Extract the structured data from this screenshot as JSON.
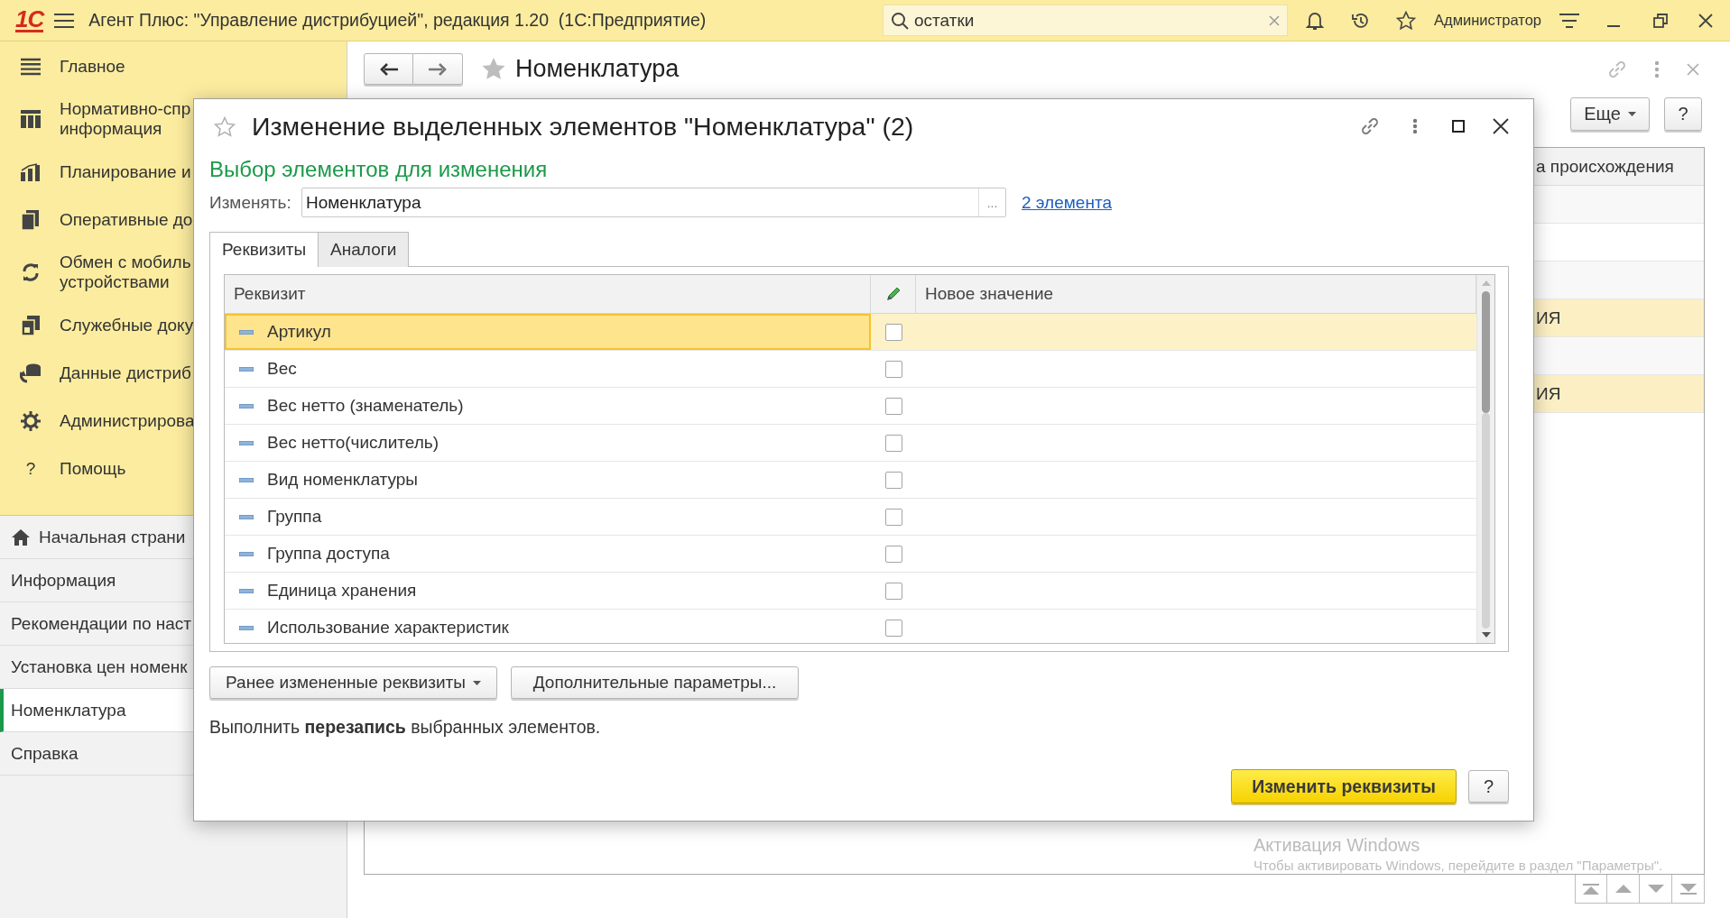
{
  "app": {
    "logo": "1С",
    "title": "Агент Плюс: \"Управление дистрибуцией\", редакция 1.20  (1С:Предприятие)",
    "search": {
      "value": "остатки"
    },
    "user": "Администратор"
  },
  "sidebar": {
    "sections": [
      {
        "label": "Главное"
      },
      {
        "label": "Нормативно-спр\nинформация"
      },
      {
        "label": "Планирование и"
      },
      {
        "label": "Оперативные до"
      },
      {
        "label": "Обмен с мобиль\nустройствами"
      },
      {
        "label": "Служебные доку"
      },
      {
        "label": "Данные дистриб"
      },
      {
        "label": "Администрирова"
      },
      {
        "label": "Помощь",
        "glyph": "?"
      }
    ],
    "open_windows": [
      {
        "label": "Начальная страни",
        "selected": false
      },
      {
        "label": "Информация",
        "selected": false
      },
      {
        "label": "Рекомендации по наст",
        "selected": false
      },
      {
        "label": "Установка цен номенк",
        "selected": false
      },
      {
        "label": "Номенклатура",
        "selected": true
      },
      {
        "label": "Справка",
        "selected": false
      }
    ]
  },
  "form": {
    "title": "Номенклатура",
    "buttons": [
      {
        "label": "Еще",
        "dropdown": true
      },
      {
        "label": "?",
        "dropdown": false
      }
    ],
    "table": {
      "column": "а происхождения",
      "rows": [
        {
          "selected": false
        },
        {
          "selected": false
        },
        {
          "selected": false
        },
        {
          "text": "ИЯ",
          "selected": true
        },
        {
          "selected": false
        },
        {
          "text": "ИЯ",
          "selected": true
        }
      ]
    }
  },
  "dialog": {
    "title": "Изменение выделенных элементов \"Номенклатура\" (2)",
    "subtitle": "Выбор элементов для изменения",
    "field": {
      "label": "Изменять:",
      "value": "Номенклатура",
      "choice": "..."
    },
    "link": "2 элемента",
    "tabs": [
      {
        "label": "Реквизиты",
        "selected": true
      },
      {
        "label": "Аналоги",
        "selected": false
      }
    ],
    "table": {
      "columns": [
        "Реквизит",
        "Новое значение"
      ],
      "rows": [
        {
          "name": "Артикул",
          "checked": false,
          "selected": true
        },
        {
          "name": "Вес",
          "checked": false,
          "selected": false
        },
        {
          "name": "Вес нетто (знаменатель)",
          "checked": false,
          "selected": false
        },
        {
          "name": "Вес нетто(числитель)",
          "checked": false,
          "selected": false
        },
        {
          "name": "Вид номенклатуры",
          "checked": false,
          "selected": false
        },
        {
          "name": "Группа",
          "checked": false,
          "selected": false
        },
        {
          "name": "Группа доступа",
          "checked": false,
          "selected": false
        },
        {
          "name": "Единица хранения",
          "checked": false,
          "selected": false
        },
        {
          "name": "Использование характеристик",
          "checked": false,
          "selected": false
        }
      ]
    },
    "buttons": [
      {
        "label": "Ранее измененные реквизиты",
        "dropdown": true
      },
      {
        "label": "Дополнительные параметры...",
        "dropdown": false
      }
    ],
    "note": "Выполнить **перезапись** выбранных элементов.",
    "primary": "Изменить реквизиты",
    "help": "?"
  },
  "windows_notice": {
    "title": "Активация Windows",
    "text": "Чтобы активировать Windows, перейдите в раздел \"Параметры\"."
  }
}
